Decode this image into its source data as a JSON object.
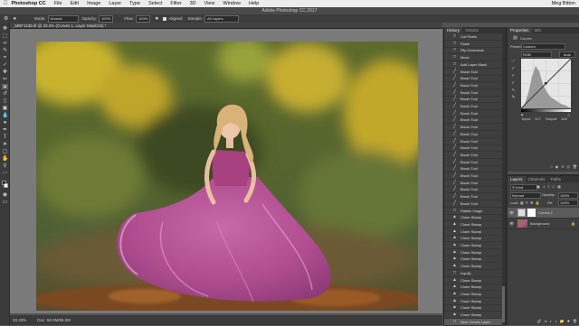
{
  "menubar": {
    "app": "Photoshop CC",
    "items": [
      "File",
      "Edit",
      "Image",
      "Layer",
      "Type",
      "Select",
      "Filter",
      "3D",
      "View",
      "Window",
      "Help"
    ],
    "user": "Meg Bitton"
  },
  "window_title": "Adobe Photoshop CC 2017",
  "options": {
    "mode_label": "Mode:",
    "mode_value": "Normal",
    "opacity_label": "Opacity:",
    "opacity_value": "100%",
    "flow_label": "Flow:",
    "flow_value": "100%",
    "aligned_label": "Aligned",
    "sample_label": "Sample:",
    "sample_value": "All Layers"
  },
  "document_tab": "_MBF1138.tif @ 33.3% (Curves 1, Layer Mask/16) *",
  "status": {
    "zoom": "33.33%",
    "doc": "Doc: 58.0M/86.0M"
  },
  "history": {
    "tabs": [
      "History",
      "Actions"
    ],
    "items": [
      {
        "icon": "history-state-icon",
        "label": "Cut Pixels"
      },
      {
        "icon": "history-state-icon",
        "label": "Paste"
      },
      {
        "icon": "history-state-icon",
        "label": "Flip Horizontal"
      },
      {
        "icon": "history-state-icon",
        "label": "Move"
      },
      {
        "icon": "history-state-icon",
        "label": "Add Layer Mask"
      },
      {
        "icon": "brush-icon",
        "label": "Brush Tool"
      },
      {
        "icon": "brush-icon",
        "label": "Brush Tool"
      },
      {
        "icon": "brush-icon",
        "label": "Brush Tool"
      },
      {
        "icon": "brush-icon",
        "label": "Brush Tool"
      },
      {
        "icon": "brush-icon",
        "label": "Brush Tool"
      },
      {
        "icon": "brush-icon",
        "label": "Brush Tool"
      },
      {
        "icon": "brush-icon",
        "label": "Brush Tool"
      },
      {
        "icon": "brush-icon",
        "label": "Brush Tool"
      },
      {
        "icon": "brush-icon",
        "label": "Brush Tool"
      },
      {
        "icon": "brush-icon",
        "label": "Brush Tool"
      },
      {
        "icon": "brush-icon",
        "label": "Brush Tool"
      },
      {
        "icon": "brush-icon",
        "label": "Brush Tool"
      },
      {
        "icon": "brush-icon",
        "label": "Brush Tool"
      },
      {
        "icon": "brush-icon",
        "label": "Brush Tool"
      },
      {
        "icon": "brush-icon",
        "label": "Brush Tool"
      },
      {
        "icon": "brush-icon",
        "label": "Brush Tool"
      },
      {
        "icon": "brush-icon",
        "label": "Brush Tool"
      },
      {
        "icon": "brush-icon",
        "label": "Brush Tool"
      },
      {
        "icon": "brush-icon",
        "label": "Brush Tool"
      },
      {
        "icon": "brush-icon",
        "label": "Brush Tool"
      },
      {
        "icon": "history-state-icon",
        "label": "Flatten Image"
      },
      {
        "icon": "stamp-icon",
        "label": "Clone Stamp"
      },
      {
        "icon": "stamp-icon",
        "label": "Clone Stamp"
      },
      {
        "icon": "stamp-icon",
        "label": "Clone Stamp"
      },
      {
        "icon": "stamp-icon",
        "label": "Clone Stamp"
      },
      {
        "icon": "stamp-icon",
        "label": "Clone Stamp"
      },
      {
        "icon": "stamp-icon",
        "label": "Clone Stamp"
      },
      {
        "icon": "stamp-icon",
        "label": "Clone Stamp"
      },
      {
        "icon": "stamp-icon",
        "label": "Clone Stamp"
      },
      {
        "icon": "history-state-icon",
        "label": "Liquify"
      },
      {
        "icon": "stamp-icon",
        "label": "Clone Stamp"
      },
      {
        "icon": "stamp-icon",
        "label": "Clone Stamp"
      },
      {
        "icon": "stamp-icon",
        "label": "Clone Stamp"
      },
      {
        "icon": "stamp-icon",
        "label": "Clone Stamp"
      },
      {
        "icon": "stamp-icon",
        "label": "Clone Stamp"
      },
      {
        "icon": "stamp-icon",
        "label": "Clone Stamp"
      },
      {
        "icon": "history-state-icon",
        "label": "New Curves Layer"
      }
    ]
  },
  "properties": {
    "tabs": [
      "Properties",
      "Info"
    ],
    "adjustment": "Curves",
    "preset_label": "Preset:",
    "preset_value": "Custom",
    "channel_value": "RGB",
    "auto_label": "Auto",
    "input_label": "Input:",
    "input_value": "127",
    "output_label": "Output:",
    "output_value": "128"
  },
  "layers": {
    "tabs": [
      "Layers",
      "Channels",
      "Paths"
    ],
    "kind_label": "Kind",
    "blend_value": "Normal",
    "opacity_label": "Opacity:",
    "opacity_value": "100%",
    "lock_label": "Lock:",
    "fill_label": "Fill:",
    "fill_value": "100%",
    "items": [
      {
        "name": "Curves 1",
        "selected": true
      },
      {
        "name": "Background",
        "selected": false
      }
    ]
  }
}
